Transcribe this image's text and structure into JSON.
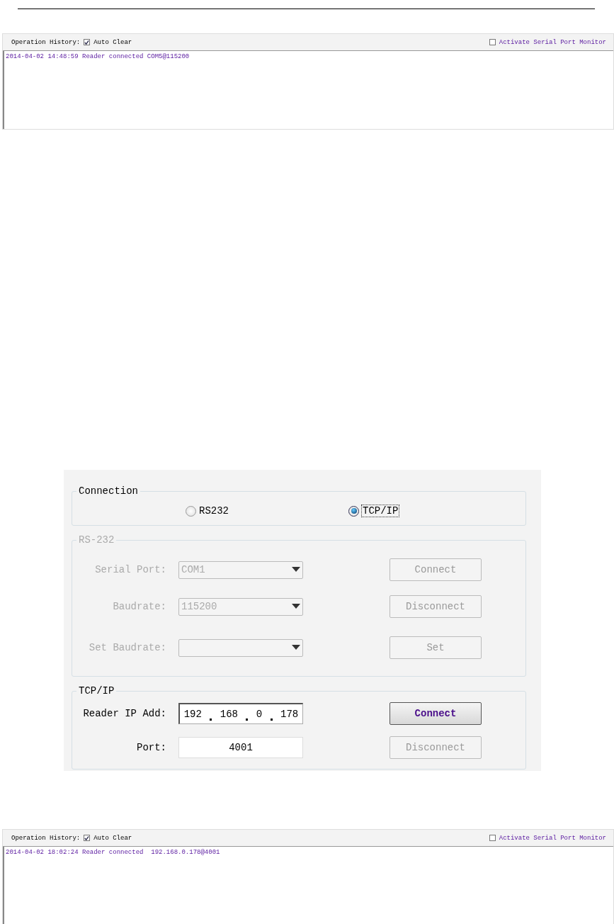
{
  "history_top": {
    "label": "Operation History:",
    "auto_clear": {
      "label": "Auto Clear",
      "checked": true
    },
    "monitor": {
      "label": "Activate Serial Port Monitor",
      "checked": false
    },
    "log": [
      "2014-04-02 14:48:59 Reader connected COM5@115200"
    ]
  },
  "connection_panel": {
    "connection": {
      "title": "Connection",
      "options": [
        {
          "label": "RS232",
          "selected": false
        },
        {
          "label": "TCP/IP",
          "selected": true
        }
      ]
    },
    "rs232": {
      "title": "RS-232",
      "disabled": true,
      "rows": [
        {
          "label": "Serial Port:",
          "value": "COM1",
          "button": "Connect"
        },
        {
          "label": "Baudrate:",
          "value": "115200",
          "button": "Disconnect"
        },
        {
          "label": "Set Baudrate:",
          "button": "Set"
        }
      ]
    },
    "tcpip": {
      "title": "TCP/IP",
      "ip_label": "Reader IP Add:",
      "ip": [
        "192",
        "168",
        "0",
        "178"
      ],
      "port_label": "Port:",
      "port": "4001",
      "buttons": [
        {
          "label": "Connect",
          "disabled": false
        },
        {
          "label": "Disconnect",
          "disabled": true
        }
      ]
    }
  },
  "history_bottom": {
    "label": "Operation History:",
    "auto_clear": {
      "label": "Auto Clear",
      "checked": true
    },
    "monitor": {
      "label": "Activate Serial Port Monitor",
      "checked": false
    },
    "log": [
      "2014-04-02 18:02:24 Reader connected  192.168.0.178@4001"
    ]
  }
}
